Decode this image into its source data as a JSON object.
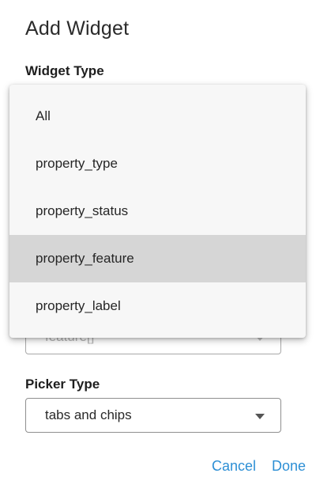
{
  "dialog": {
    "title": "Add Widget"
  },
  "widget_type": {
    "label": "Widget Type",
    "options": [
      "All",
      "property_type",
      "property_status",
      "property_feature",
      "property_label"
    ],
    "highlighted_index": 3
  },
  "obscured_field": {
    "value": "feature[]"
  },
  "picker_type": {
    "label": "Picker Type",
    "value": "tabs and chips"
  },
  "actions": {
    "cancel": "Cancel",
    "done": "Done"
  },
  "colors": {
    "accent": "#2d8fd5",
    "highlight": "#d6d6d6"
  }
}
